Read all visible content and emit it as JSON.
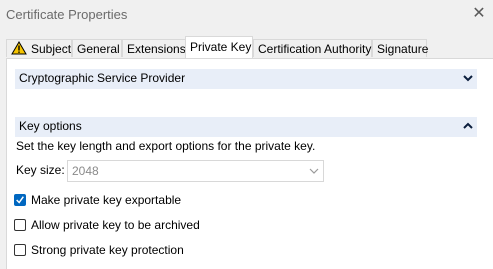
{
  "window": {
    "title": "Certificate Properties"
  },
  "tabs": [
    {
      "label": "Subject",
      "icon": "warning-icon"
    },
    {
      "label": "General"
    },
    {
      "label": "Extensions"
    },
    {
      "label": "Private Key",
      "active": true
    },
    {
      "label": "Certification Authority"
    },
    {
      "label": "Signature"
    }
  ],
  "sections": {
    "csp": {
      "label": "Cryptographic Service Provider",
      "expanded": false
    },
    "key_options": {
      "label": "Key options",
      "expanded": true,
      "description": "Set the key length and export options for the private key.",
      "key_size_label": "Key size:",
      "key_size_value": "2048",
      "checkboxes": [
        {
          "label": "Make private key exportable",
          "checked": true
        },
        {
          "label": "Allow private key to be archived",
          "checked": false
        },
        {
          "label": "Strong private key protection",
          "checked": false
        }
      ]
    }
  },
  "colors": {
    "accent": "#0067c0",
    "section_header_bg": "#e8eef8",
    "warning": "#f5c400"
  }
}
